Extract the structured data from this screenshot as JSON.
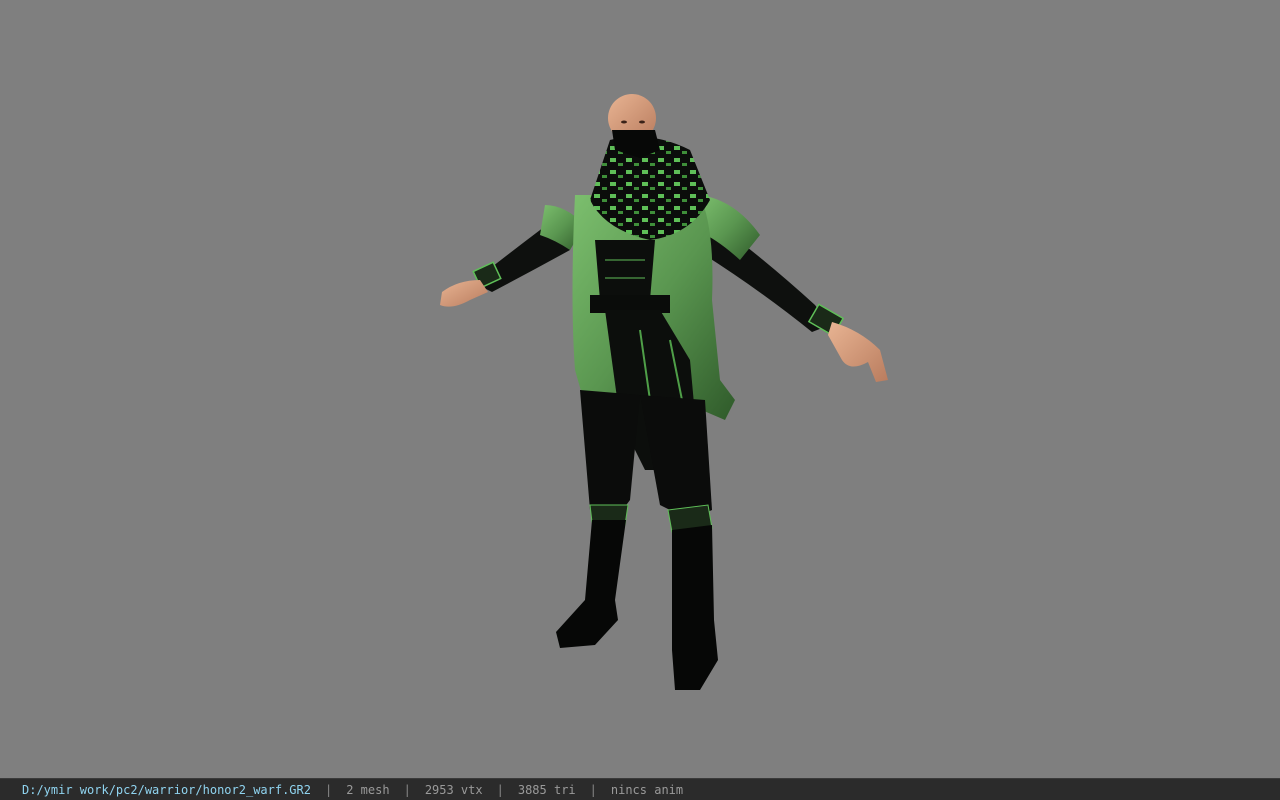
{
  "status": {
    "file_path": "D:/ymir work/pc2/warrior/honor2_warf.GR2",
    "separator": "|",
    "mesh": "2 mesh",
    "vtx": "2953 vtx",
    "tri": "3885 tri",
    "anim": "nincs anim"
  },
  "colors": {
    "background": "#7f7f7f",
    "status_bar": "#2b2b2b",
    "path_text": "#8fd3ef",
    "status_text": "#9a9a9a",
    "armor_green": "#5e9a55",
    "armor_dark": "#0d0f0d",
    "skin": "#d9a07f"
  }
}
